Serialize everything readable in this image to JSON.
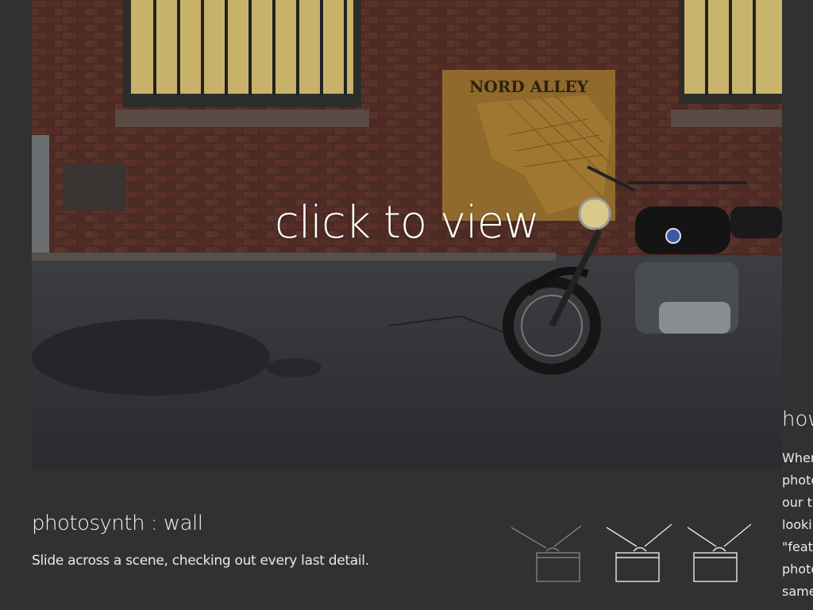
{
  "viewer": {
    "cta_label": "click to view",
    "sign_text": "NORD ALLEY"
  },
  "caption": {
    "title": "photosynth : wall",
    "subtitle": "Slide across a scene, checking out every last detail."
  },
  "modes": [
    {
      "icon": "wall-mode-icon",
      "state": "dim"
    },
    {
      "icon": "spin-mode-icon",
      "state": "active"
    },
    {
      "icon": "walk-mode-icon",
      "state": "active"
    }
  ],
  "side_panel": {
    "heading": "how",
    "lines": [
      "When",
      "photo",
      "our t",
      "looki",
      "\"featu",
      "photo",
      "same"
    ]
  },
  "colors": {
    "background": "#313131",
    "text": "#f2f2f2",
    "icon_active": "#ffffff",
    "icon_dim": "#9a9a9a"
  }
}
